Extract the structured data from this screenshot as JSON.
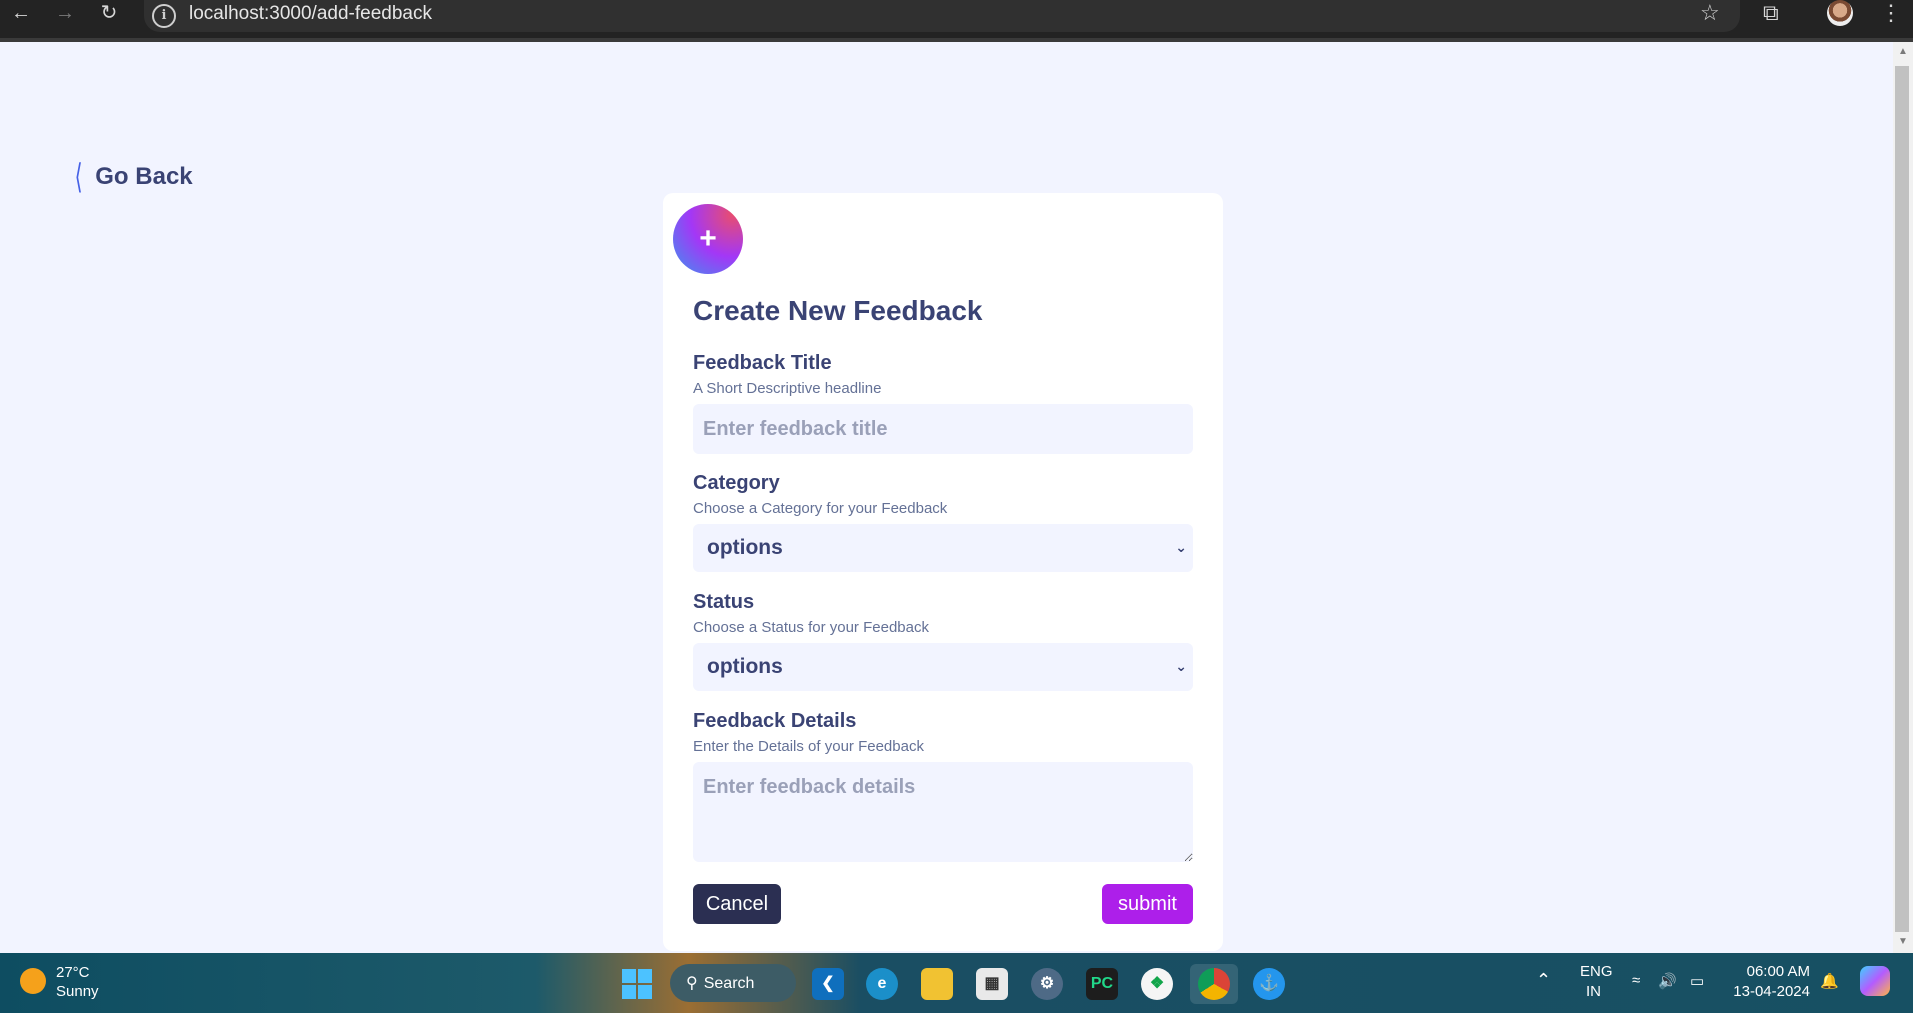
{
  "browser": {
    "url": "localhost:3000/add-feedback",
    "back_icon": "arrow-left-icon",
    "forward_icon": "arrow-right-icon",
    "reload_icon": "reload-icon"
  },
  "page": {
    "go_back_label": "Go Back",
    "form_title": "Create New Feedback",
    "title_field": {
      "label": "Feedback Title",
      "hint": "A Short Descriptive headline",
      "placeholder": "Enter feedback title"
    },
    "category_field": {
      "label": "Category",
      "hint": "Choose a Category for your Feedback",
      "selected": "options"
    },
    "status_field": {
      "label": "Status",
      "hint": "Choose a Status for your Feedback",
      "selected": "options"
    },
    "details_field": {
      "label": "Feedback Details",
      "hint": "Enter the Details of your Feedback",
      "placeholder": "Enter feedback details"
    },
    "cancel_label": "Cancel",
    "submit_label": "submit"
  },
  "colors": {
    "accent_purple": "#ad1fea",
    "dark_navy": "#3a4374",
    "button_dark": "#2b2f52",
    "link_blue": "#4661e6",
    "page_bg": "#f2f4ff"
  },
  "taskbar": {
    "weather_temp": "27°C",
    "weather_cond": "Sunny",
    "search_label": "Search",
    "lang_primary": "ENG",
    "lang_secondary": "IN",
    "time": "06:00 AM",
    "date": "13-04-2024"
  }
}
